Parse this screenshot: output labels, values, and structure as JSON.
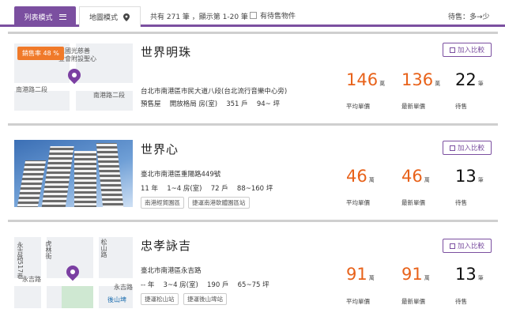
{
  "toolbar": {
    "tab_list": "列表模式",
    "tab_map": "地圖模式",
    "summary": "共有 271 筆 ，顯示第 1-20 筆",
    "checkbox_label": "有待售物件",
    "sort": "待售：多→少"
  },
  "listings": [
    {
      "name": "世界明珠",
      "address": "台北市南港區市民大道八段(台北流行音樂中心旁)",
      "meta": "預售屋　 開放格局 房(室)　 351 戶　 94~ 坪",
      "badge": "銷售率 48 %",
      "map_labels": [
        "法人國光慈善",
        "金會附設聖心",
        "南港路二段",
        "南港路二段"
      ],
      "tags": [],
      "compare": "加入比較",
      "stats": [
        {
          "value": "146",
          "unit": "萬",
          "label": "平均單價"
        },
        {
          "value": "136",
          "unit": "萬",
          "label": "最新單價"
        },
        {
          "value": "22",
          "unit": "筆",
          "label": "待售"
        }
      ]
    },
    {
      "name": "世界心",
      "address": "臺北市南港區重陽路449號",
      "meta": "11 年　 1~4 房(室)　 72 戶　 88~160 坪",
      "badge": "",
      "map_labels": [],
      "tags": [
        "南港經貿園區",
        "捷運南港軟體園區站"
      ],
      "compare": "加入比較",
      "stats": [
        {
          "value": "46",
          "unit": "萬",
          "label": "平均單價"
        },
        {
          "value": "46",
          "unit": "萬",
          "label": "最新單價"
        },
        {
          "value": "13",
          "unit": "筆",
          "label": "待售"
        }
      ]
    },
    {
      "name": "忠孝詠吉",
      "address": "臺北市南港區永吉路",
      "meta": "-- 年　 3~4 房(室)　 190 戶　 65~75 坪",
      "badge": "",
      "map_labels": [
        "虎林街",
        "永吉路517巷",
        "松山路",
        "永吉路",
        "永吉路",
        "後山埤"
      ],
      "tags": [
        "捷運松山站",
        "捷運後山埤站"
      ],
      "compare": "加入比較",
      "stats": [
        {
          "value": "91",
          "unit": "萬",
          "label": "平均單價"
        },
        {
          "value": "91",
          "unit": "萬",
          "label": "最新單價"
        },
        {
          "value": "13",
          "unit": "筆",
          "label": "待售"
        }
      ]
    }
  ],
  "colors": {
    "accent": "#7b4fa0",
    "price": "#e8621a",
    "badge": "#f07a2a"
  }
}
